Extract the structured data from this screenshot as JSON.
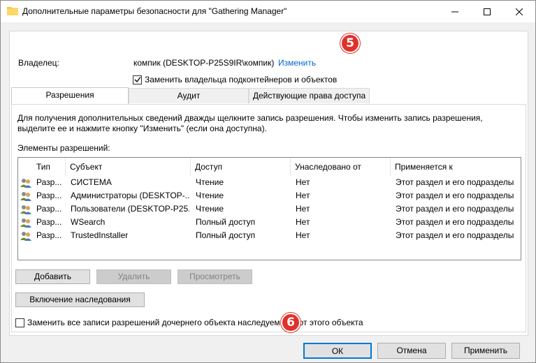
{
  "window": {
    "title": "Дополнительные параметры безопасности  для \"Gathering Manager\""
  },
  "owner": {
    "label": "Владелец:",
    "value": "компик (DESKTOP-P25S9IR\\компик)",
    "change_link": "Изменить",
    "replace_checkbox_label": "Заменить владельца подконтейнеров и объектов",
    "replace_checked": true
  },
  "badges": {
    "step5": "5",
    "step6": "6"
  },
  "tabs": [
    {
      "label": "Разрешения",
      "active": true
    },
    {
      "label": "Аудит",
      "active": false
    },
    {
      "label": "Действующие права доступа",
      "active": false
    }
  ],
  "permissions": {
    "info": "Для получения дополнительных сведений дважды щелкните запись разрешения. Чтобы изменить запись разрешения, выделите ее и нажмите кнопку \"Изменить\" (если она доступна).",
    "list_label": "Элементы разрешений:",
    "columns": [
      "Тип",
      "Субъект",
      "Доступ",
      "Унаследовано от",
      "Применяется к"
    ],
    "rows": [
      {
        "type": "Разр...",
        "subject": "СИСТЕМА",
        "access": "Чтение",
        "inherited": "Нет",
        "applies": "Этот раздел и его подразделы"
      },
      {
        "type": "Разр...",
        "subject": "Администраторы (DESKTOP-...",
        "access": "Чтение",
        "inherited": "Нет",
        "applies": "Этот раздел и его подразделы"
      },
      {
        "type": "Разр...",
        "subject": "Пользователи (DESKTOP-P25...",
        "access": "Чтение",
        "inherited": "Нет",
        "applies": "Этот раздел и его подразделы"
      },
      {
        "type": "Разр...",
        "subject": "WSearch",
        "access": "Полный доступ",
        "inherited": "Нет",
        "applies": "Этот раздел и его подразделы"
      },
      {
        "type": "Разр...",
        "subject": "TrustedInstaller",
        "access": "Полный доступ",
        "inherited": "Нет",
        "applies": "Этот раздел и его подразделы"
      }
    ]
  },
  "buttons": {
    "add": "Добавить",
    "remove": "Удалить",
    "view": "Просмотреть",
    "inheritance": "Включение наследования",
    "ok": "ОК",
    "cancel": "Отмена",
    "apply": "Применить"
  },
  "replace_all": {
    "label": "Заменить все записи разрешений дочернего объекта наследуемыми от этого объекта",
    "checked": false
  },
  "colors": {
    "accent": "#0078d7",
    "link": "#0066cc",
    "badge": "#e0312b"
  }
}
